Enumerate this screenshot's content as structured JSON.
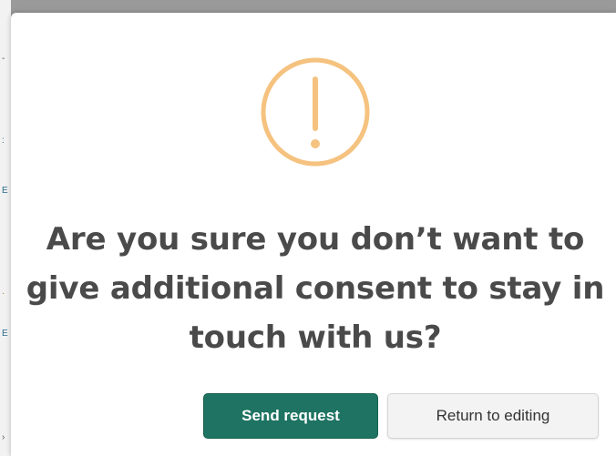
{
  "dialog": {
    "title": "Are you sure you don’t want to give additional consent to stay in touch with us?",
    "icon": "exclamation-circle-icon",
    "primary_button_label": "Send request",
    "secondary_button_label": "Return to editing"
  },
  "colors": {
    "icon_accent": "#f5c27f",
    "primary_button": "#1e7362",
    "title_text": "#4a4a4a"
  }
}
